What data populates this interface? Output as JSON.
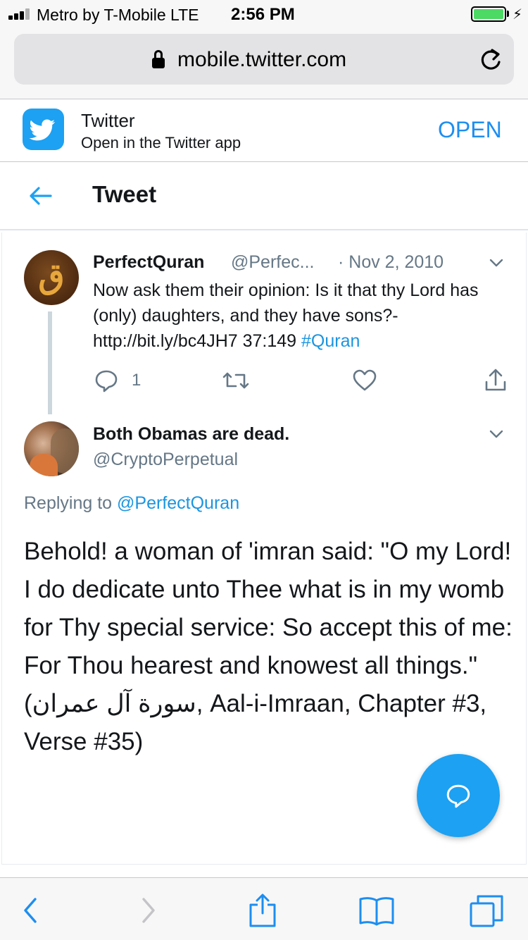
{
  "status_bar": {
    "carrier": "Metro by T-Mobile  LTE",
    "time": "2:56 PM",
    "battery_level": 1.0,
    "charging": true
  },
  "browser": {
    "url": "mobile.twitter.com",
    "icons": {
      "secure": "lock-icon",
      "reload": "reload-icon"
    }
  },
  "app_banner": {
    "app_name": "Twitter",
    "subtitle": "Open in the Twitter app",
    "open_label": "OPEN"
  },
  "header": {
    "title": "Tweet",
    "back_icon": "back-arrow-icon"
  },
  "tweets": [
    {
      "display_name": "PerfectQuran",
      "handle": "@Perfec...",
      "date": "· Nov 2, 2010",
      "avatar_glyph": "ق",
      "text_before_tag": "Now ask them their opinion: Is it that thy Lord has (only) daughters, and they have sons?- http://bit.ly/bc4JH7 37:149 ",
      "hashtag": "#Quran",
      "reply_count": "1"
    },
    {
      "display_name": "Both Obamas are dead.",
      "handle": "@CryptoPerpetual",
      "replying_prefix": "Replying to ",
      "replying_to": "@PerfectQuran",
      "text": "Behold! a woman of 'imran said: \"O my Lord! I do dedicate unto Thee what is in my womb for Thy special service: So accept this of me: For Thou hearest and knowest all things.\" (سورة آل عمران, Aal-i-Imraan, Chapter #3, Verse #35)"
    }
  ],
  "colors": {
    "twitter_blue": "#1da1f2",
    "link_blue": "#1b95e0",
    "secondary_text": "#657786",
    "ios_blue": "#1d8ef0"
  },
  "toolbar": {
    "items": [
      "back-icon",
      "forward-icon",
      "share-icon",
      "bookmarks-icon",
      "tabs-icon"
    ]
  }
}
